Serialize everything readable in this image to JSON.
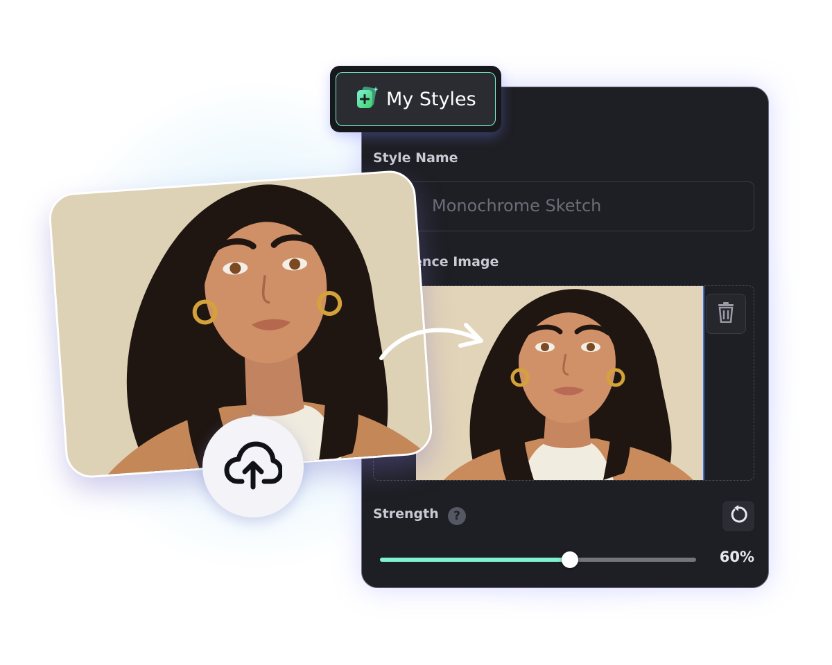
{
  "header": {
    "title": "My Styles",
    "icon": "add-style-icon"
  },
  "form": {
    "style_name_label": "Style Name",
    "style_name_placeholder": "Monochrome Sketch",
    "reference_image_label": "Reference Image",
    "strength_label": "Strength",
    "strength_help": "?",
    "strength_value": 0.6,
    "strength_display": "60%"
  },
  "colors": {
    "accent": "#7ff2d4",
    "panel_bg": "#1e1f24"
  },
  "icons": {
    "upload": "cloud-upload-icon",
    "delete": "trash-icon",
    "reset": "reset-icon",
    "help": "help-icon",
    "arrow": "curved-arrow-icon"
  }
}
